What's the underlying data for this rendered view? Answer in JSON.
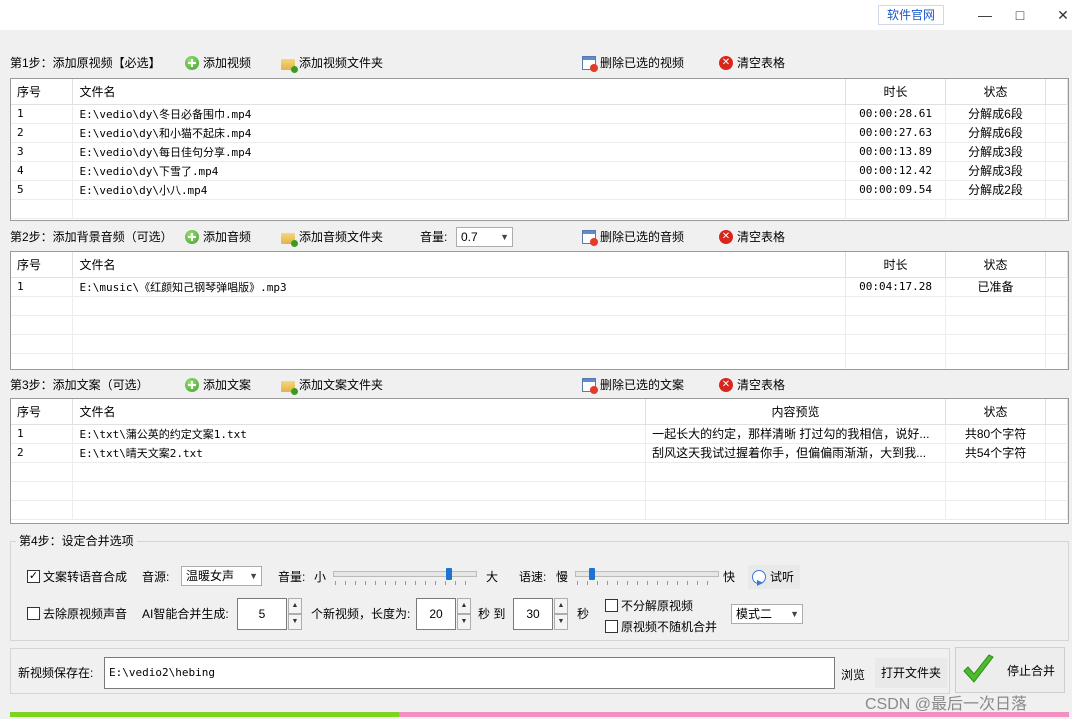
{
  "window": {
    "official_site": "软件官网",
    "minimize": "—",
    "maximize": "□",
    "close": "✕"
  },
  "step1": {
    "label": "第1步：添加原视频【必选】",
    "add_label": "添加视频",
    "add_folder_label": "添加视频文件夹",
    "delete_label": "删除已选的视频",
    "clear_label": "清空表格",
    "headers": {
      "num": "序号",
      "file": "文件名",
      "duration": "时长",
      "status": "状态"
    },
    "rows": [
      {
        "num": "1",
        "file": "E:\\vedio\\dy\\冬日必备围巾.mp4",
        "duration": "00:00:28.61",
        "status": "分解成6段"
      },
      {
        "num": "2",
        "file": "E:\\vedio\\dy\\和小猫不起床.mp4",
        "duration": "00:00:27.63",
        "status": "分解成6段"
      },
      {
        "num": "3",
        "file": "E:\\vedio\\dy\\每日佳句分享.mp4",
        "duration": "00:00:13.89",
        "status": "分解成3段"
      },
      {
        "num": "4",
        "file": "E:\\vedio\\dy\\下雪了.mp4",
        "duration": "00:00:12.42",
        "status": "分解成3段"
      },
      {
        "num": "5",
        "file": "E:\\vedio\\dy\\小八.mp4",
        "duration": "00:00:09.54",
        "status": "分解成2段"
      }
    ]
  },
  "step2": {
    "label": "第2步：添加背景音频（可选）",
    "add_label": "添加音频",
    "add_folder_label": "添加音频文件夹",
    "volume_label": "音量:",
    "volume_value": "0.7",
    "delete_label": "删除已选的音频",
    "clear_label": "清空表格",
    "headers": {
      "num": "序号",
      "file": "文件名",
      "duration": "时长",
      "status": "状态"
    },
    "rows": [
      {
        "num": "1",
        "file": "E:\\music\\《红颜知己钢琴弹唱版》.mp3",
        "duration": "00:04:17.28",
        "status": "已准备"
      }
    ]
  },
  "step3": {
    "label": "第3步：添加文案（可选）",
    "add_label": "添加文案",
    "add_folder_label": "添加文案文件夹",
    "delete_label": "删除已选的文案",
    "clear_label": "清空表格",
    "headers": {
      "num": "序号",
      "file": "文件名",
      "preview": "内容预览",
      "status": "状态"
    },
    "rows": [
      {
        "num": "1",
        "file": "E:\\txt\\蒲公英的约定文案1.txt",
        "preview": "一起长大的约定，那样清晰 打过勾的我相信，说好...",
        "status": "共80个字符"
      },
      {
        "num": "2",
        "file": "E:\\txt\\晴天文案2.txt",
        "preview": "刮风这天我试过握着你手，但偏偏雨渐渐，大到我...",
        "status": "共54个字符"
      }
    ]
  },
  "step4": {
    "label": "第4步：设定合并选项",
    "tts_label": "文案转语音合成",
    "tts_checked": true,
    "voice_label": "音源:",
    "voice_value": "温暖女声",
    "volume_label": "音量:",
    "volume_min": "小",
    "volume_max": "大",
    "volume_level": 0.82,
    "speed_label": "语速:",
    "speed_min": "慢",
    "speed_max": "快",
    "speed_level": 0.1,
    "listen_label": "试听",
    "remove_audio_label": "去除原视频声音",
    "remove_audio_checked": false,
    "ai_label": "AI智能合并生成:",
    "count_value": "5",
    "count_unit": "个新视频，长度为:",
    "len_min": "20",
    "sec_to": "秒 到",
    "len_max": "30",
    "sec": "秒",
    "no_split_label": "不分解原视频",
    "no_random_label": "原视频不随机合并",
    "mode_value": "模式二"
  },
  "save": {
    "label": "新视频保存在:",
    "path": "E:\\vedio2\\hebing",
    "browse": "浏览",
    "open_folder": "打开文件夹",
    "stop_label": "停止合并"
  },
  "progress": {
    "fraction": 0.367,
    "done_color": "#7ed321",
    "remaining_color": "#f48fc1"
  },
  "watermark": "CSDN @最后一次日落"
}
